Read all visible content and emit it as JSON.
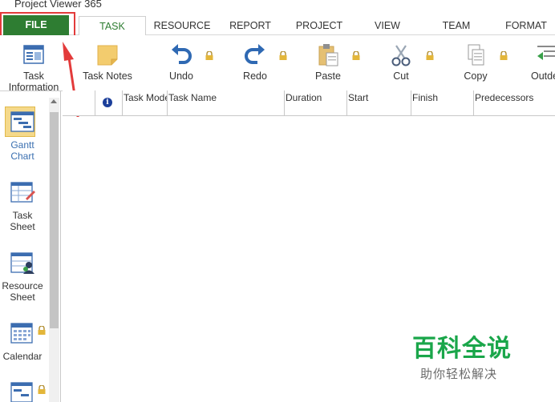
{
  "app": {
    "title": "Project Viewer 365"
  },
  "ribbon": {
    "tabs": [
      {
        "label": "FILE",
        "active": false
      },
      {
        "label": "TASK",
        "active": true
      },
      {
        "label": "RESOURCE",
        "active": false
      },
      {
        "label": "REPORT",
        "active": false
      },
      {
        "label": "PROJECT",
        "active": false
      },
      {
        "label": "VIEW",
        "active": false
      },
      {
        "label": "TEAM",
        "active": false
      },
      {
        "label": "FORMAT",
        "active": false
      }
    ]
  },
  "toolbar": {
    "items": [
      {
        "label": "Task Information",
        "line1": "Task",
        "line2": "Information",
        "icon": "task-information-icon",
        "locked": false
      },
      {
        "label": "Task Notes",
        "icon": "task-notes-icon",
        "locked": false
      },
      {
        "label": "Undo",
        "icon": "undo-icon",
        "locked": true
      },
      {
        "label": "Redo",
        "icon": "redo-icon",
        "locked": true
      },
      {
        "label": "Paste",
        "icon": "paste-icon",
        "locked": true
      },
      {
        "label": "Cut",
        "icon": "cut-icon",
        "locked": true
      },
      {
        "label": "Copy",
        "icon": "copy-icon",
        "locked": true
      },
      {
        "label": "Outde",
        "icon": "outdent-icon",
        "locked": false
      }
    ]
  },
  "views": [
    {
      "line1": "Gantt",
      "line2": "Chart",
      "icon": "gantt-chart-icon",
      "active": true,
      "locked": false
    },
    {
      "line1": "Task",
      "line2": "Sheet",
      "icon": "task-sheet-icon",
      "active": false,
      "locked": false
    },
    {
      "line1": "Resource",
      "line2": "Sheet",
      "icon": "resource-sheet-icon",
      "active": false,
      "locked": false
    },
    {
      "line1": "Calendar",
      "line2": "",
      "icon": "calendar-icon",
      "active": false,
      "locked": true
    },
    {
      "line1": "",
      "line2": "",
      "icon": "network-diagram-icon",
      "active": false,
      "locked": true
    }
  ],
  "grid": {
    "columns": [
      "Task Mode",
      "Task Name",
      "Duration",
      "Start",
      "Finish",
      "Predecessors"
    ],
    "info_glyph": "i"
  },
  "watermark": {
    "main": "百科全说",
    "sub": "助你轻松解决"
  },
  "colors": {
    "file_tab": "#2e7d32",
    "highlight": "#e33b3b",
    "accent_blue": "#3a6fb0",
    "watermark": "#1aa64a"
  }
}
